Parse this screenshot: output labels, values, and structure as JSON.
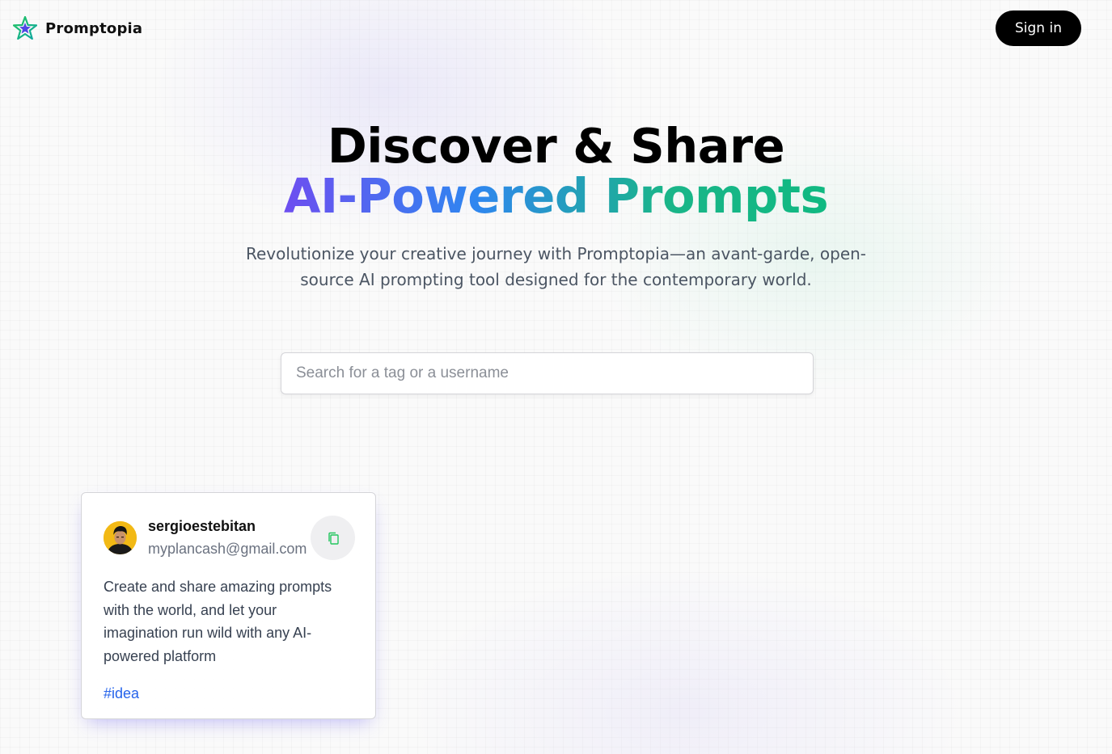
{
  "nav": {
    "brand": "Promptopia",
    "logo_icon": "star-logo-icon",
    "signin_label": "Sign in"
  },
  "hero": {
    "title_line1": "Discover & Share",
    "title_line2": "AI-Powered Prompts",
    "description_line1": "Revolutionize your creative journey with Promptopia—an avant-garde, open-",
    "description_line2": "source AI prompting tool designed for the contemporary world."
  },
  "search": {
    "placeholder": "Search for a tag or a username",
    "value": ""
  },
  "prompts": [
    {
      "username": "sergioestebitan",
      "email": "myplancash@gmail.com",
      "prompt": "Create and share amazing prompts with the world, and let your imagination run wild with any AI-powered platform",
      "tag": "#idea",
      "copy_icon": "copy-icon"
    }
  ],
  "colors": {
    "gradient_start": "#6d4ef0",
    "gradient_mid": "#2f86f0",
    "gradient_end": "#10b981",
    "tag_color": "#2563eb",
    "button_bg": "#000000"
  }
}
